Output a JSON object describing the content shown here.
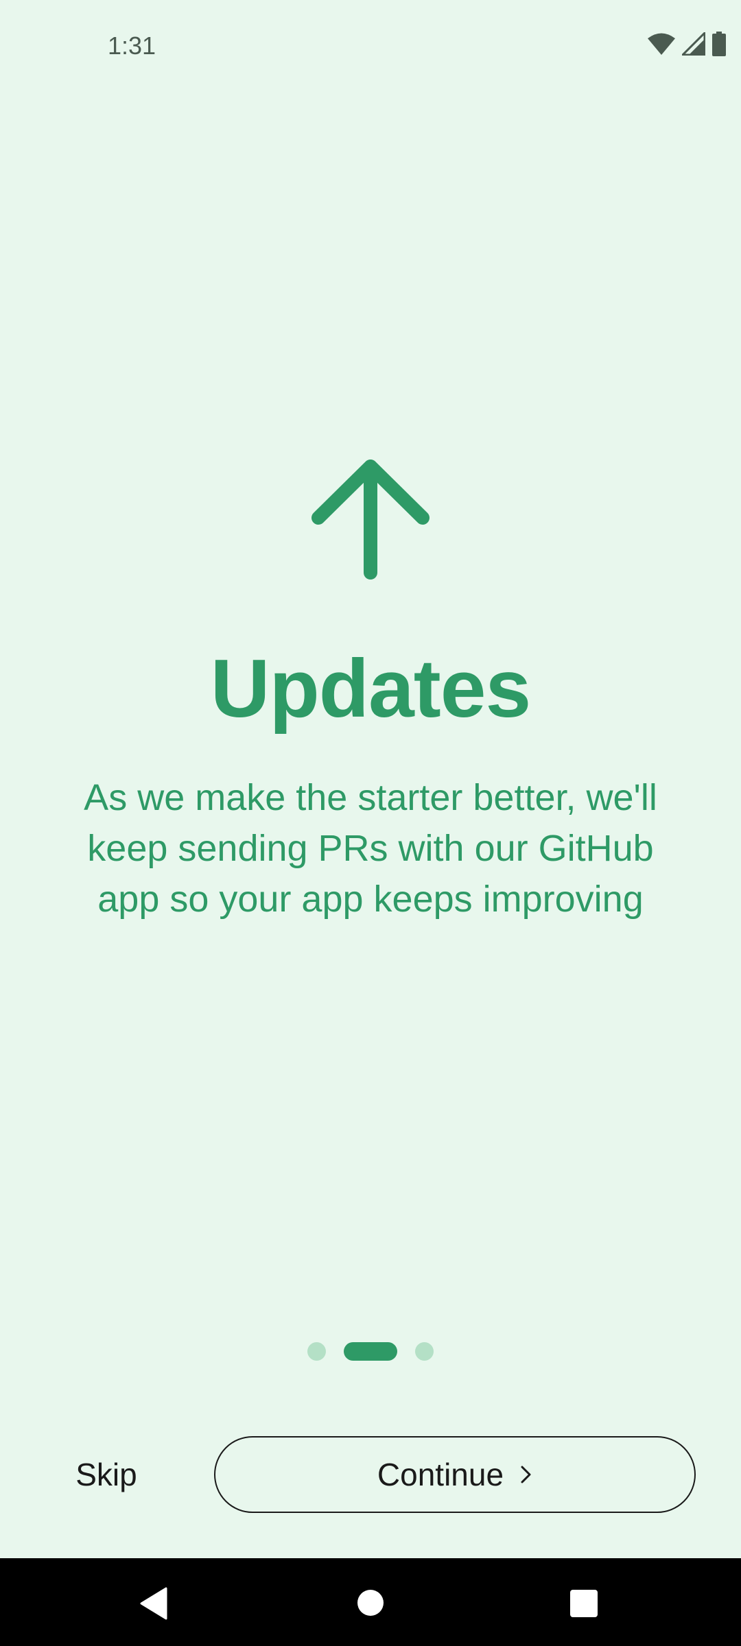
{
  "status_bar": {
    "time": "1:31",
    "icons": [
      "wifi-icon",
      "cellular-signal-icon",
      "battery-icon"
    ]
  },
  "onboarding": {
    "icon": "arrow-up-icon",
    "title": "Updates",
    "description": "As we make the starter better, we'll keep sending PRs with our GitHub app so your app keeps improving",
    "page_indicator": {
      "total": 3,
      "current": 2
    }
  },
  "actions": {
    "skip_label": "Skip",
    "continue_label": "Continue",
    "continue_icon": "chevron-right-icon"
  },
  "nav_bar": {
    "buttons": [
      "back",
      "home",
      "recents"
    ]
  },
  "colors": {
    "background": "#e8f7ed",
    "accent": "#2e9a66",
    "indicator_inactive": "#b4e0c6"
  }
}
